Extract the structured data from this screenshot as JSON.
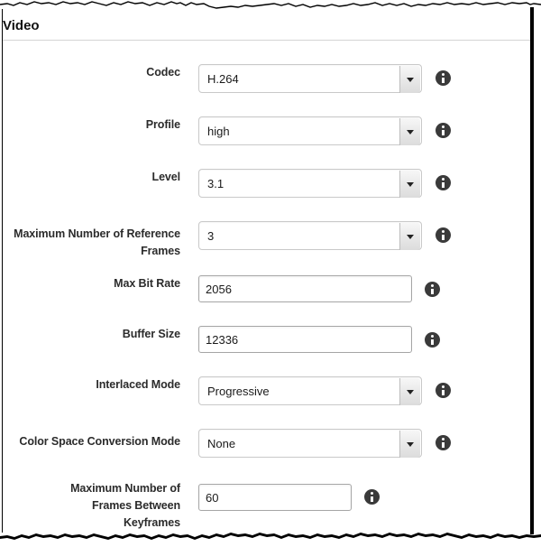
{
  "panel": {
    "section_title": "Video"
  },
  "fields": [
    {
      "label": "Codec",
      "type": "select",
      "value": "H.264",
      "icon": "info-icon"
    },
    {
      "label": "Profile",
      "type": "select",
      "value": "high",
      "icon": "info-icon"
    },
    {
      "label": "Level",
      "type": "select",
      "value": "3.1",
      "icon": "info-icon"
    },
    {
      "label": "Maximum Number of Reference Frames",
      "type": "select",
      "value": "3",
      "icon": "info-icon"
    },
    {
      "label": "Max Bit Rate",
      "type": "text",
      "value": "2056",
      "icon": "info-icon"
    },
    {
      "label": "Buffer Size",
      "type": "text",
      "value": "12336",
      "icon": "info-icon"
    },
    {
      "label": "Interlaced Mode",
      "type": "select",
      "value": "Progressive",
      "icon": "info-icon"
    },
    {
      "label": "Color Space Conversion Mode",
      "type": "select",
      "value": "None",
      "icon": "info-icon"
    },
    {
      "label": "Maximum Number of Frames Between Keyframes",
      "type": "text",
      "value": "60",
      "icon": "info-icon"
    }
  ],
  "colors": {
    "text": "#2b2b2b",
    "border": "#c9c9c9",
    "icon_fill": "#3a3a3a",
    "rule": "#d4d4d4"
  }
}
